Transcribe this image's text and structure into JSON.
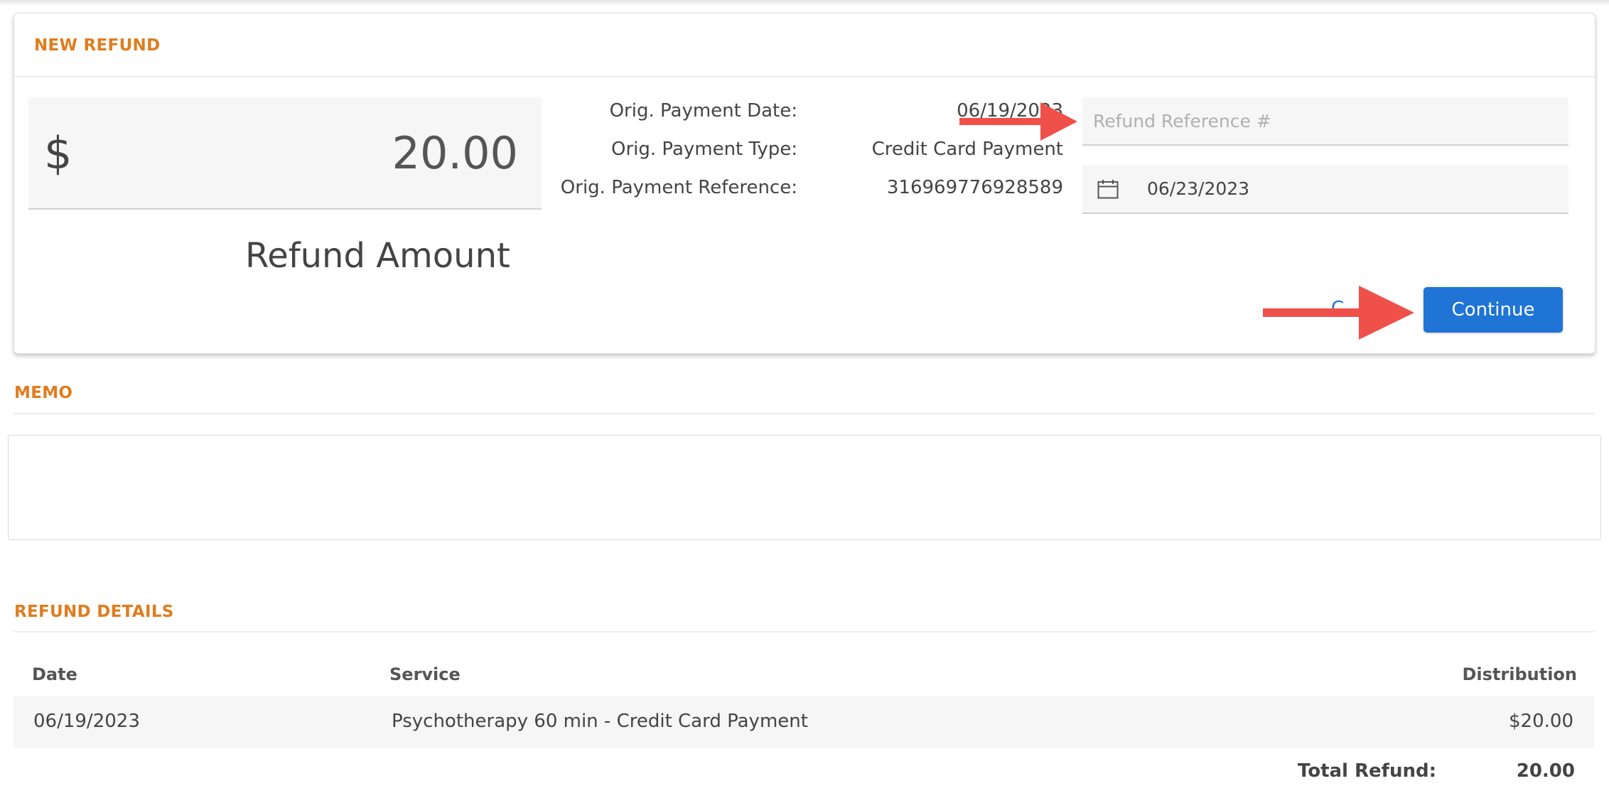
{
  "card": {
    "title": "NEW REFUND",
    "amount": {
      "currency_symbol": "$",
      "value": "20.00",
      "caption": "Refund Amount"
    },
    "payment_info": [
      {
        "label": "Orig. Payment Date:",
        "value": "06/19/2023"
      },
      {
        "label": "Orig. Payment Type:",
        "value": "Credit Card Payment"
      },
      {
        "label": "Orig. Payment Reference:",
        "value": "316969776928589"
      }
    ],
    "reference_input": {
      "placeholder": "Refund Reference #",
      "value": ""
    },
    "refund_date": {
      "icon": "calendar-icon",
      "value": "06/23/2023"
    },
    "cancel_label": "C",
    "continue_label": "Continue"
  },
  "memo": {
    "title": "MEMO",
    "value": ""
  },
  "refund_details": {
    "title": "REFUND DETAILS",
    "columns": {
      "date": "Date",
      "service": "Service",
      "distribution": "Distribution"
    },
    "rows": [
      {
        "date": "06/19/2023",
        "service": "Psychotherapy 60 min - Credit Card Payment",
        "distribution": "$20.00"
      }
    ],
    "total_label": "Total Refund:",
    "total_value": "20.00"
  },
  "colors": {
    "accent": "#e07c1e",
    "primary_button": "#1f74d6",
    "annotation_arrow": "#f0504a"
  }
}
